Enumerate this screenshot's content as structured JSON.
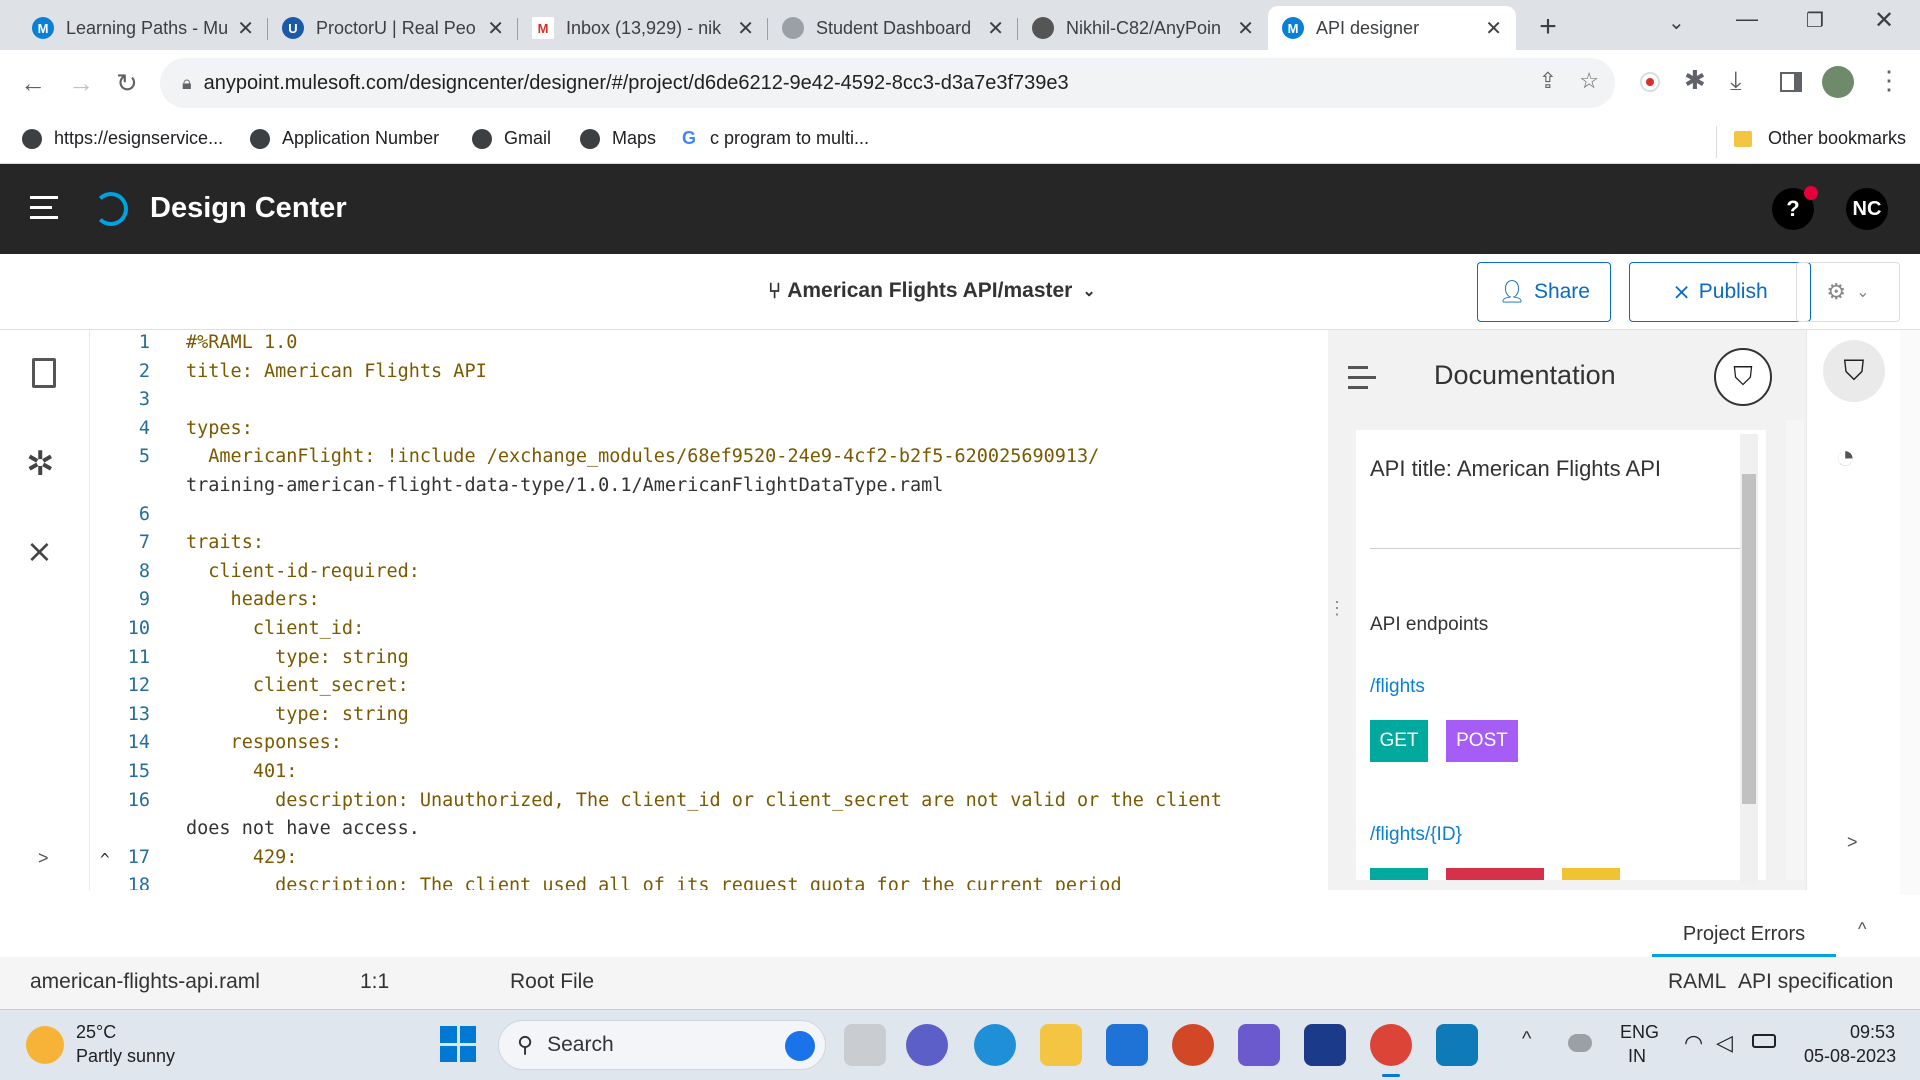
{
  "browser": {
    "tabs": [
      {
        "title": "Learning Paths - Mu",
        "favicon": "mulesoft-icon",
        "color": "#0a7fd6"
      },
      {
        "title": "ProctorU | Real Peo",
        "favicon": "proctoru-icon",
        "color": "#1c5aa6"
      },
      {
        "title": "Inbox (13,929) - nik",
        "favicon": "gmail-icon",
        "color": "#d93025"
      },
      {
        "title": "Student Dashboard",
        "favicon": "globe-icon",
        "color": "#9aa0a6"
      },
      {
        "title": "Nikhil-C82/AnyPoin",
        "favicon": "github-icon",
        "color": "#555"
      },
      {
        "title": "API designer",
        "favicon": "mulesoft-icon",
        "color": "#0a7fd6"
      }
    ],
    "close_glyph": "✕",
    "new_tab_glyph": "+",
    "url": "anypoint.mulesoft.com/designcenter/designer/#/project/d6de6212-9e42-4592-8cc3-d3a7e3f739e3",
    "bookmarks": [
      {
        "label": "https://esignservice..."
      },
      {
        "label": "Application Number"
      },
      {
        "label": "Gmail"
      },
      {
        "label": "Maps"
      },
      {
        "label": "c program to multi..."
      }
    ],
    "other_bookmarks": "Other bookmarks"
  },
  "app": {
    "title": "Design Center",
    "help": "?",
    "user_initials": "NC",
    "project": "American Flights API/master",
    "share_label": "Share",
    "publish_label": "Publish"
  },
  "editor": {
    "lines": [
      {
        "n": "1",
        "text": "#%RAML 1.0"
      },
      {
        "n": "2",
        "text": "title: American Flights API"
      },
      {
        "n": "3",
        "text": ""
      },
      {
        "n": "4",
        "text": "types:"
      },
      {
        "n": "5",
        "text": "  AmericanFlight: !include /exchange_modules/68ef9520-24e9-4cf2-b2f5-620025690913/"
      },
      {
        "n": "",
        "text": "training-american-flight-data-type/1.0.1/AmericanFlightDataType.raml"
      },
      {
        "n": "6",
        "text": ""
      },
      {
        "n": "7",
        "text": "traits:"
      },
      {
        "n": "8",
        "text": "  client-id-required:"
      },
      {
        "n": "9",
        "text": "    headers:"
      },
      {
        "n": "10",
        "text": "      client_id:"
      },
      {
        "n": "11",
        "text": "        type: string"
      },
      {
        "n": "12",
        "text": "      client_secret:"
      },
      {
        "n": "13",
        "text": "        type: string"
      },
      {
        "n": "14",
        "text": "    responses:"
      },
      {
        "n": "15",
        "text": "      401:"
      },
      {
        "n": "16",
        "text": "        description: Unauthorized, The client_id or client_secret are not valid or the client"
      },
      {
        "n": "",
        "text": "does not have access."
      },
      {
        "n": "17",
        "text": "      429:"
      },
      {
        "n": "18",
        "text": "        description: The client used all of its request quota for the current period"
      }
    ],
    "collapse_glyph": ">",
    "fold_glyph": "^"
  },
  "documentation": {
    "heading": "Documentation",
    "api_title": "API title: American Flights API",
    "endpoints_label": "API endpoints",
    "endpoints": [
      {
        "path": "/flights",
        "methods": [
          "GET",
          "POST"
        ]
      },
      {
        "path": "/flights/{ID}",
        "methods": []
      }
    ],
    "method_colors": {
      "GET": "#00a99d",
      "POST": "#a55df6",
      "DELETE": "#d6314b",
      "PATCH": "#f1c232"
    },
    "expand_glyph": ">"
  },
  "bottom": {
    "project_errors": "Project Errors",
    "file_name": "american-flights-api.raml",
    "cursor": "1:1",
    "root_file": "Root File",
    "lang": "RAML",
    "spec": "API specification"
  },
  "taskbar": {
    "temp": "25°C",
    "weather": "Partly sunny",
    "search": "Search",
    "lang1": "ENG",
    "lang2": "IN",
    "time": "09:53",
    "date": "05-08-2023"
  }
}
